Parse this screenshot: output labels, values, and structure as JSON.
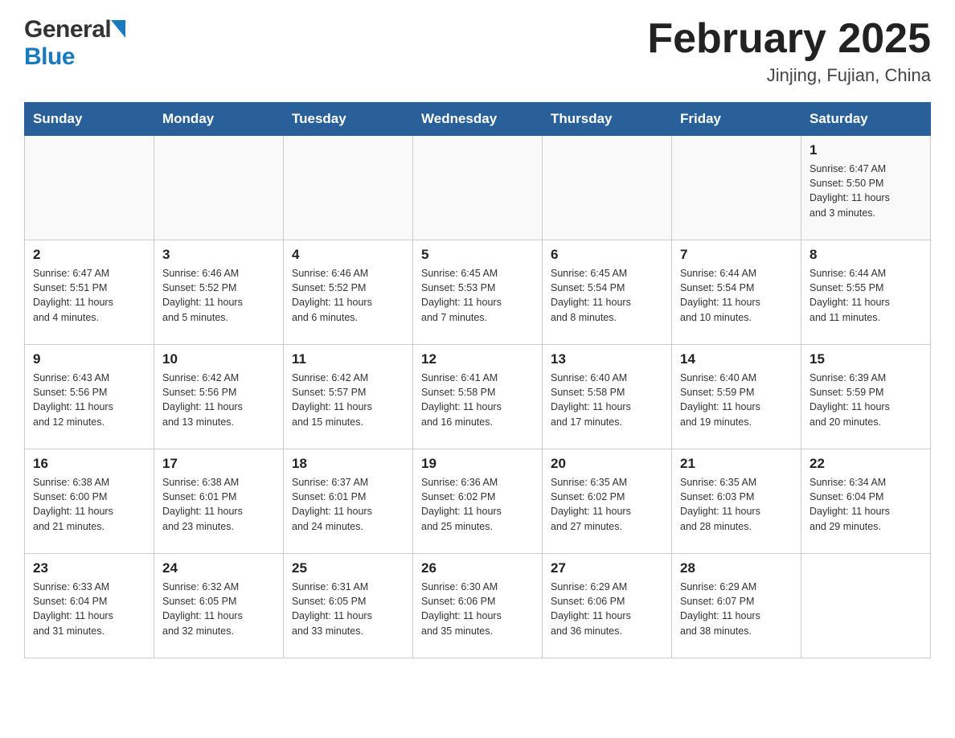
{
  "header": {
    "logo_general": "General",
    "logo_blue": "Blue",
    "month_title": "February 2025",
    "location": "Jinjing, Fujian, China"
  },
  "weekdays": [
    "Sunday",
    "Monday",
    "Tuesday",
    "Wednesday",
    "Thursday",
    "Friday",
    "Saturday"
  ],
  "weeks": [
    [
      {
        "day": "",
        "info": ""
      },
      {
        "day": "",
        "info": ""
      },
      {
        "day": "",
        "info": ""
      },
      {
        "day": "",
        "info": ""
      },
      {
        "day": "",
        "info": ""
      },
      {
        "day": "",
        "info": ""
      },
      {
        "day": "1",
        "info": "Sunrise: 6:47 AM\nSunset: 5:50 PM\nDaylight: 11 hours\nand 3 minutes."
      }
    ],
    [
      {
        "day": "2",
        "info": "Sunrise: 6:47 AM\nSunset: 5:51 PM\nDaylight: 11 hours\nand 4 minutes."
      },
      {
        "day": "3",
        "info": "Sunrise: 6:46 AM\nSunset: 5:52 PM\nDaylight: 11 hours\nand 5 minutes."
      },
      {
        "day": "4",
        "info": "Sunrise: 6:46 AM\nSunset: 5:52 PM\nDaylight: 11 hours\nand 6 minutes."
      },
      {
        "day": "5",
        "info": "Sunrise: 6:45 AM\nSunset: 5:53 PM\nDaylight: 11 hours\nand 7 minutes."
      },
      {
        "day": "6",
        "info": "Sunrise: 6:45 AM\nSunset: 5:54 PM\nDaylight: 11 hours\nand 8 minutes."
      },
      {
        "day": "7",
        "info": "Sunrise: 6:44 AM\nSunset: 5:54 PM\nDaylight: 11 hours\nand 10 minutes."
      },
      {
        "day": "8",
        "info": "Sunrise: 6:44 AM\nSunset: 5:55 PM\nDaylight: 11 hours\nand 11 minutes."
      }
    ],
    [
      {
        "day": "9",
        "info": "Sunrise: 6:43 AM\nSunset: 5:56 PM\nDaylight: 11 hours\nand 12 minutes."
      },
      {
        "day": "10",
        "info": "Sunrise: 6:42 AM\nSunset: 5:56 PM\nDaylight: 11 hours\nand 13 minutes."
      },
      {
        "day": "11",
        "info": "Sunrise: 6:42 AM\nSunset: 5:57 PM\nDaylight: 11 hours\nand 15 minutes."
      },
      {
        "day": "12",
        "info": "Sunrise: 6:41 AM\nSunset: 5:58 PM\nDaylight: 11 hours\nand 16 minutes."
      },
      {
        "day": "13",
        "info": "Sunrise: 6:40 AM\nSunset: 5:58 PM\nDaylight: 11 hours\nand 17 minutes."
      },
      {
        "day": "14",
        "info": "Sunrise: 6:40 AM\nSunset: 5:59 PM\nDaylight: 11 hours\nand 19 minutes."
      },
      {
        "day": "15",
        "info": "Sunrise: 6:39 AM\nSunset: 5:59 PM\nDaylight: 11 hours\nand 20 minutes."
      }
    ],
    [
      {
        "day": "16",
        "info": "Sunrise: 6:38 AM\nSunset: 6:00 PM\nDaylight: 11 hours\nand 21 minutes."
      },
      {
        "day": "17",
        "info": "Sunrise: 6:38 AM\nSunset: 6:01 PM\nDaylight: 11 hours\nand 23 minutes."
      },
      {
        "day": "18",
        "info": "Sunrise: 6:37 AM\nSunset: 6:01 PM\nDaylight: 11 hours\nand 24 minutes."
      },
      {
        "day": "19",
        "info": "Sunrise: 6:36 AM\nSunset: 6:02 PM\nDaylight: 11 hours\nand 25 minutes."
      },
      {
        "day": "20",
        "info": "Sunrise: 6:35 AM\nSunset: 6:02 PM\nDaylight: 11 hours\nand 27 minutes."
      },
      {
        "day": "21",
        "info": "Sunrise: 6:35 AM\nSunset: 6:03 PM\nDaylight: 11 hours\nand 28 minutes."
      },
      {
        "day": "22",
        "info": "Sunrise: 6:34 AM\nSunset: 6:04 PM\nDaylight: 11 hours\nand 29 minutes."
      }
    ],
    [
      {
        "day": "23",
        "info": "Sunrise: 6:33 AM\nSunset: 6:04 PM\nDaylight: 11 hours\nand 31 minutes."
      },
      {
        "day": "24",
        "info": "Sunrise: 6:32 AM\nSunset: 6:05 PM\nDaylight: 11 hours\nand 32 minutes."
      },
      {
        "day": "25",
        "info": "Sunrise: 6:31 AM\nSunset: 6:05 PM\nDaylight: 11 hours\nand 33 minutes."
      },
      {
        "day": "26",
        "info": "Sunrise: 6:30 AM\nSunset: 6:06 PM\nDaylight: 11 hours\nand 35 minutes."
      },
      {
        "day": "27",
        "info": "Sunrise: 6:29 AM\nSunset: 6:06 PM\nDaylight: 11 hours\nand 36 minutes."
      },
      {
        "day": "28",
        "info": "Sunrise: 6:29 AM\nSunset: 6:07 PM\nDaylight: 11 hours\nand 38 minutes."
      },
      {
        "day": "",
        "info": ""
      }
    ]
  ]
}
